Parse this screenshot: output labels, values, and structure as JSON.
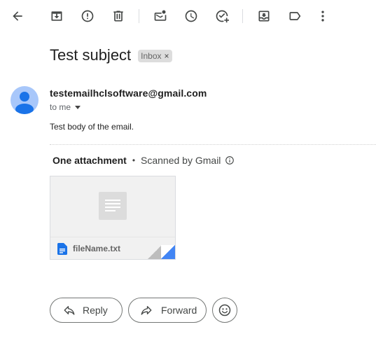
{
  "toolbar": {
    "items": [
      {
        "icon": "back-arrow-icon"
      },
      {
        "icon": "archive-icon"
      },
      {
        "icon": "report-spam-icon"
      },
      {
        "icon": "delete-icon"
      },
      {
        "icon": "mark-unread-icon"
      },
      {
        "icon": "snooze-icon"
      },
      {
        "icon": "add-to-tasks-icon"
      },
      {
        "icon": "move-to-icon"
      },
      {
        "icon": "label-icon"
      },
      {
        "icon": "more-options-icon"
      }
    ]
  },
  "email": {
    "subject": "Test subject",
    "label": "Inbox",
    "label_remove": "×",
    "sender": "testemailhclsoftware@gmail.com",
    "recipient": "to me",
    "body": "Test body of the email."
  },
  "attachments": {
    "count_label": "One attachment",
    "separator": "•",
    "scan_label": "Scanned by Gmail",
    "files": [
      {
        "name": "fileName.txt"
      }
    ]
  },
  "actions": {
    "reply_label": "Reply",
    "forward_label": "Forward"
  },
  "colors": {
    "avatar_bg": "#a8c7fa",
    "avatar_fg": "#1a73e8",
    "file_icon": "#1a73e8",
    "fold_blue": "#4285f4"
  }
}
